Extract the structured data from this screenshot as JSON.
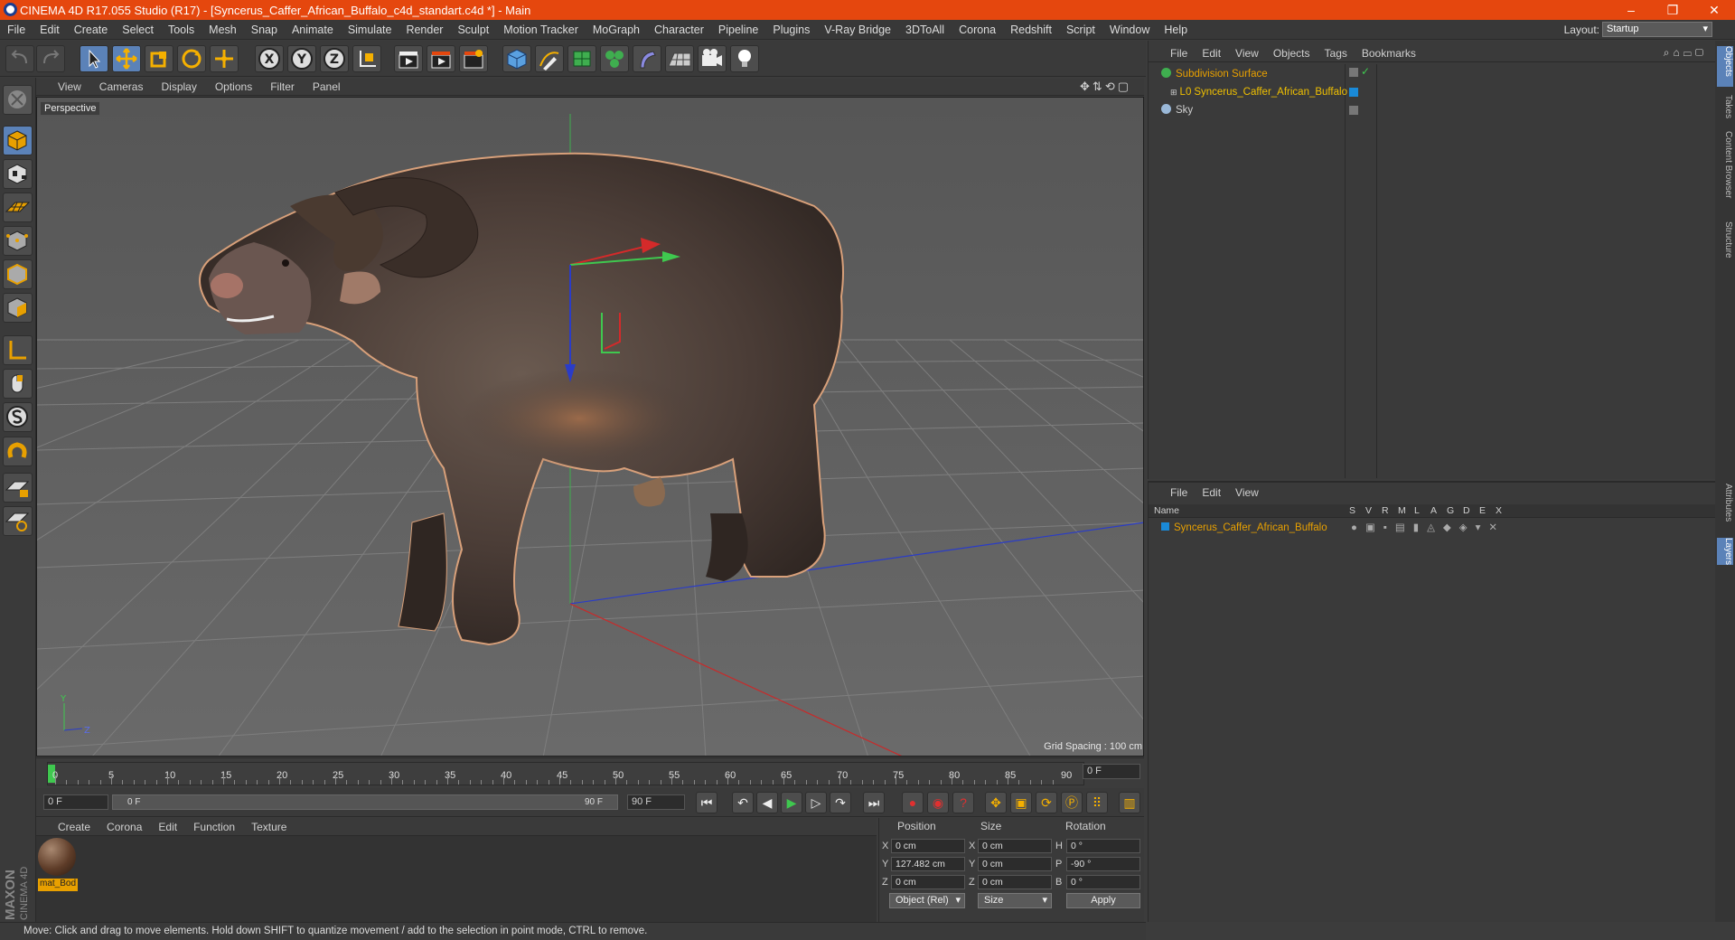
{
  "window": {
    "title": "CINEMA 4D R17.055 Studio (R17) - [Syncerus_Caffer_African_Buffalo_c4d_standart.c4d *] - Main",
    "minimize": "–",
    "restore": "❐",
    "close": "✕"
  },
  "menu": [
    "File",
    "Edit",
    "Create",
    "Select",
    "Tools",
    "Mesh",
    "Snap",
    "Animate",
    "Simulate",
    "Render",
    "Sculpt",
    "Motion Tracker",
    "MoGraph",
    "Character",
    "Pipeline",
    "Plugins",
    "V-Ray Bridge",
    "3DToAll",
    "Corona",
    "Redshift",
    "Script",
    "Window",
    "Help"
  ],
  "layout": {
    "label": "Layout:",
    "value": "Startup"
  },
  "toolbar": {
    "axis_x": "X",
    "axis_y": "Y",
    "axis_z": "Z"
  },
  "viewport": {
    "menu": [
      "View",
      "Cameras",
      "Display",
      "Options",
      "Filter",
      "Panel"
    ],
    "camera": "Perspective",
    "grid_spacing": "Grid Spacing : 100 cm",
    "axis_y": "Y",
    "axis_z": "Z"
  },
  "timeline": {
    "ticks": [
      "0",
      "5",
      "10",
      "15",
      "20",
      "25",
      "30",
      "35",
      "40",
      "45",
      "50",
      "55",
      "60",
      "65",
      "70",
      "75",
      "80",
      "85",
      "90"
    ],
    "current": "0 F",
    "start": "0 F",
    "slider_start": "0 F",
    "slider_end": "90 F",
    "end": "90 F",
    "playhead": 0
  },
  "material_panel": {
    "menu": [
      "Create",
      "Corona",
      "Edit",
      "Function",
      "Texture"
    ],
    "material_name": "mat_Bod"
  },
  "coords": {
    "headers": [
      "Position",
      "Size",
      "Rotation"
    ],
    "position": [
      {
        "axis": "X",
        "value": "0 cm"
      },
      {
        "axis": "Y",
        "value": "127.482 cm"
      },
      {
        "axis": "Z",
        "value": "0 cm"
      }
    ],
    "size": [
      {
        "axis": "X",
        "value": "0 cm"
      },
      {
        "axis": "Y",
        "value": "0 cm"
      },
      {
        "axis": "Z",
        "value": "0 cm"
      }
    ],
    "rotation": [
      {
        "axis": "H",
        "value": "0 °"
      },
      {
        "axis": "P",
        "value": "-90 °"
      },
      {
        "axis": "B",
        "value": "0 °"
      }
    ],
    "mode": "Object (Rel)",
    "size_mode": "Size",
    "apply": "Apply"
  },
  "status": "Move: Click and drag to move elements. Hold down SHIFT to quantize movement / add to the selection in point mode, CTRL to remove.",
  "object_manager": {
    "menu": [
      "File",
      "Edit",
      "View",
      "Objects",
      "Tags",
      "Bookmarks"
    ],
    "objects": [
      {
        "name": "Subdivision Surface",
        "color": "#e8a000"
      },
      {
        "name": "Syncerus_Caffer_African_Buffalo",
        "color": "#f0c000"
      },
      {
        "name": "Sky",
        "color": "#cfcfcf"
      }
    ]
  },
  "layer_manager": {
    "menu": [
      "File",
      "Edit",
      "View"
    ],
    "columns": [
      "Name",
      "S",
      "V",
      "R",
      "M",
      "L",
      "A",
      "G",
      "D",
      "E",
      "X"
    ],
    "layer": "Syncerus_Caffer_African_Buffalo"
  },
  "side_tabs": [
    "Objects",
    "Takes",
    "Content Browser",
    "Structure",
    "Attributes",
    "Layers"
  ],
  "brand": {
    "maxon": "MAXON",
    "cinema": "CINEMA 4D"
  },
  "colors": {
    "titlebar": "#e5470e",
    "accent": "#5b82b8",
    "selection": "#e8a000"
  }
}
